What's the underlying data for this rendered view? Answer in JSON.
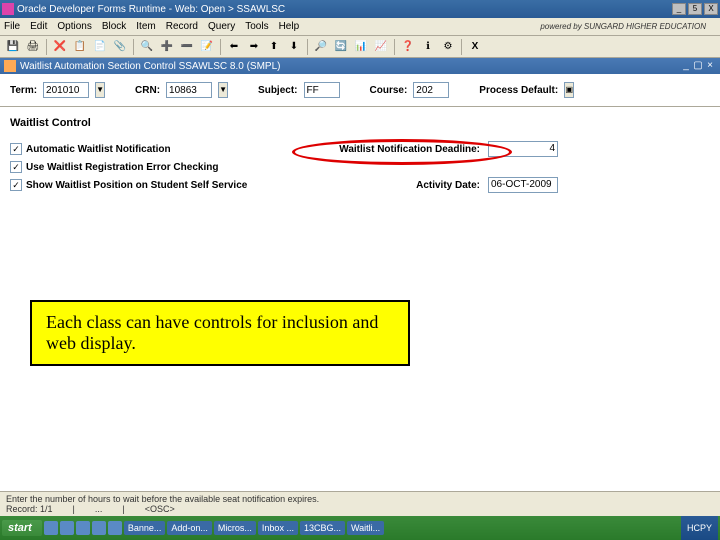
{
  "window": {
    "title": "Oracle Developer Forms Runtime - Web: Open > SSAWLSC",
    "min": "_",
    "restore": "▢",
    "close": "X",
    "sub_restore": "5"
  },
  "menu": {
    "file": "File",
    "edit": "Edit",
    "options": "Options",
    "block": "Block",
    "item": "Item",
    "record": "Record",
    "query": "Query",
    "tools": "Tools",
    "help": "Help",
    "brand": "powered by SUNGARD HIGHER EDUCATION"
  },
  "toolbar_icons": [
    "💾",
    "🖨",
    "❌",
    "📋",
    "📄",
    "📎",
    "🔍",
    "➕",
    "➖",
    "📝",
    "⬅",
    "➡",
    "⬆",
    "⬇",
    "🔎",
    "🔄",
    "📊",
    "📈",
    "❓",
    "ℹ",
    "⚙",
    "X"
  ],
  "subheader": {
    "title": "Waitlist Automation Section Control  SSAWLSC  8.0  (SMPL)"
  },
  "key": {
    "term_label": "Term:",
    "term_value": "201010",
    "crn_label": "CRN:",
    "crn_value": "10863",
    "subject_label": "Subject:",
    "subject_value": "FF",
    "course_label": "Course:",
    "course_value": "202",
    "procdef_label": "Process Default:"
  },
  "section": {
    "title": "Waitlist Control",
    "check1": "Automatic Waitlist Notification",
    "check2": "Use Waitlist Registration Error Checking",
    "check3": "Show Waitlist Position on Student Self Service",
    "checkmark": "✓",
    "deadline_label": "Waitlist Notification Deadline:",
    "deadline_value": "4",
    "activity_label": "Activity Date:",
    "activity_value": "06-OCT-2009"
  },
  "callout": {
    "text": "Each class can have controls for inclusion and web display."
  },
  "status": {
    "hint": "Enter the number of hours to wait before the available seat notification expires.",
    "record": "Record: 1/1",
    "osc": "<OSC>"
  },
  "taskbar": {
    "start": "start",
    "items": [
      "Banne...",
      "Add-on...",
      "Micros...",
      "Inbox ...",
      "13CBG...",
      "Waitli..."
    ],
    "time": "HCPY"
  }
}
